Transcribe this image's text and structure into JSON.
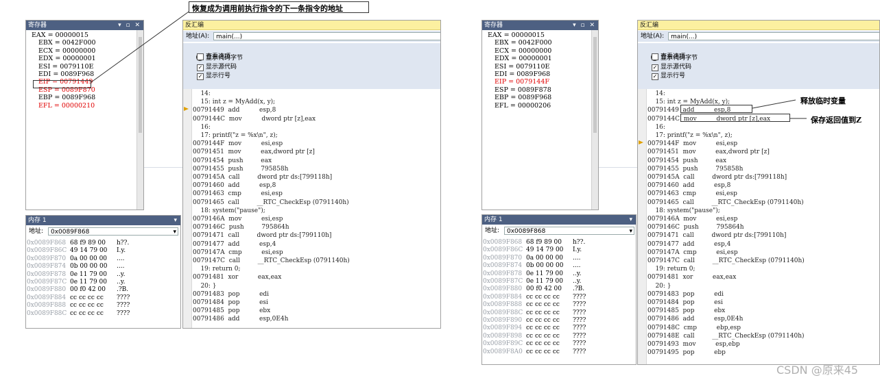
{
  "left": {
    "registers": {
      "title": "寄存器",
      "lines": [
        "EAX = 00000015",
        "EBX = 0042F000",
        "ECX = 00000000",
        "EDX = 00000001",
        "ESI = 0079110E",
        "EDI = 0089F968",
        "EIP = 00791449",
        "ESP = 0089F870",
        "EBP = 0089F968",
        "EFL = 00000210"
      ],
      "red_indices": [
        6,
        7,
        9
      ]
    },
    "disasm": {
      "title": "反汇编",
      "address_label": "地址(A):",
      "address_value": "main(...)",
      "options_header": "查看选项",
      "options": [
        {
          "label": "显示代码字节",
          "checked": false
        },
        {
          "label": "显示源代码",
          "checked": true
        },
        {
          "label": "显示行号",
          "checked": true
        }
      ],
      "code": [
        "    14:",
        "    15: int z = MyAdd(x, y);",
        "00791449  add          esp,8",
        "0079144C  mov          dword ptr [z],eax",
        "    16:",
        "    17: printf(\"z = %x\\n\", z);",
        "0079144F  mov          esi,esp",
        "00791451  mov          eax,dword ptr [z]",
        "00791454  push         eax",
        "00791455  push         795858h",
        "0079145A  call         dword ptr ds:[799118h]",
        "00791460  add          esp,8",
        "00791463  cmp          esi,esp",
        "00791465  call         __RTC_CheckEsp (0791140h)",
        "    18: system(\"pause\");",
        "0079146A  mov          esi,esp",
        "0079146C  push         795864h",
        "00791471  call         dword ptr ds:[799110h]",
        "00791477  add          esp,4",
        "0079147A  cmp          esi,esp",
        "0079147C  call         __RTC_CheckEsp (0791140h)",
        "    19: return 0;",
        "00791481  xor          eax,eax",
        "    20: }",
        "00791483  pop          edi",
        "00791484  pop          esi",
        "00791485  pop          ebx",
        "00791486  add          esp,0E4h"
      ],
      "current_line": 2
    },
    "memory": {
      "title": "内存 1",
      "address_label": "地址:",
      "address_value": "0x0089F868",
      "rows": [
        {
          "addr": "0x0089F868",
          "bytes": "68 f9 89 00",
          "ascii": "h??."
        },
        {
          "addr": "0x0089F86C",
          "bytes": "49 14 79 00",
          "ascii": "I.y."
        },
        {
          "addr": "0x0089F870",
          "bytes": "0a 00 00 00",
          "ascii": "...."
        },
        {
          "addr": "0x0089F874",
          "bytes": "0b 00 00 00",
          "ascii": "...."
        },
        {
          "addr": "0x0089F878",
          "bytes": "0e 11 79 00",
          "ascii": "..y."
        },
        {
          "addr": "0x0089F87C",
          "bytes": "0e 11 79 00",
          "ascii": "..y."
        },
        {
          "addr": "0x0089F880",
          "bytes": "00 f0 42 00",
          "ascii": ".?B."
        },
        {
          "addr": "0x0089F884",
          "bytes": "cc cc cc cc",
          "ascii": "????"
        },
        {
          "addr": "0x0089F888",
          "bytes": "cc cc cc cc",
          "ascii": "????"
        },
        {
          "addr": "0x0089F88C",
          "bytes": "cc cc cc cc",
          "ascii": "????"
        }
      ]
    },
    "annotation": "恢复成为调用前执行指令的下一条指令的地址"
  },
  "right": {
    "registers": {
      "title": "寄存器",
      "lines": [
        "EAX = 00000015",
        "EBX = 0042F000",
        "ECX = 00000000",
        "EDX = 00000001",
        "ESI = 0079110E",
        "EDI = 0089F968",
        "EIP = 0079144F",
        "ESP = 0089F878",
        "EBP = 0089F968",
        "EFL = 00000206"
      ],
      "red_indices": [
        6
      ]
    },
    "disasm": {
      "title": "反汇编",
      "address_label": "地址(A):",
      "address_value": "main(...)",
      "options_header": "查看选项",
      "options": [
        {
          "label": "显示代码字节",
          "checked": false
        },
        {
          "label": "显示源代码",
          "checked": true
        },
        {
          "label": "显示行号",
          "checked": true
        }
      ],
      "code": [
        "    14:",
        "    15: int z = MyAdd(x, y);",
        "00791449  add          esp,8",
        "0079144C  mov          dword ptr [z],eax",
        "    16:",
        "    17: printf(\"z = %x\\n\", z);",
        "0079144F  mov          esi,esp",
        "00791451  mov          eax,dword ptr [z]",
        "00791454  push         eax",
        "00791455  push         795858h",
        "0079145A  call         dword ptr ds:[799118h]",
        "00791460  add          esp,8",
        "00791463  cmp          esi,esp",
        "00791465  call         __RTC_CheckEsp (0791140h)",
        "    18: system(\"pause\");",
        "0079146A  mov          esi,esp",
        "0079146C  push         795864h",
        "00791471  call         dword ptr ds:[799110h]",
        "00791477  add          esp,4",
        "0079147A  cmp          esi,esp",
        "0079147C  call         __RTC_CheckEsp (0791140h)",
        "    19: return 0;",
        "00791481  xor          eax,eax",
        "    20: }",
        "00791483  pop          edi",
        "00791484  pop          esi",
        "00791485  pop          ebx",
        "00791486  add          esp,0E4h",
        "0079148C  cmp          ebp,esp",
        "0079148E  call         __RTC_CheckEsp (0791140h)",
        "00791493  mov          esp,ebp",
        "00791495  pop          ebp"
      ],
      "current_line": 6
    },
    "memory": {
      "title": "内存 1",
      "address_label": "地址:",
      "address_value": "0x0089F868",
      "rows": [
        {
          "addr": "0x0089F868",
          "bytes": "68 f9 89 00",
          "ascii": "h??."
        },
        {
          "addr": "0x0089F86C",
          "bytes": "49 14 79 00",
          "ascii": "I.y."
        },
        {
          "addr": "0x0089F870",
          "bytes": "0a 00 00 00",
          "ascii": "...."
        },
        {
          "addr": "0x0089F874",
          "bytes": "0b 00 00 00",
          "ascii": "...."
        },
        {
          "addr": "0x0089F878",
          "bytes": "0e 11 79 00",
          "ascii": "..y."
        },
        {
          "addr": "0x0089F87C",
          "bytes": "0e 11 79 00",
          "ascii": "..y."
        },
        {
          "addr": "0x0089F880",
          "bytes": "00 f0 42 00",
          "ascii": ".?B."
        },
        {
          "addr": "0x0089F884",
          "bytes": "cc cc cc cc",
          "ascii": "????"
        },
        {
          "addr": "0x0089F888",
          "bytes": "cc cc cc cc",
          "ascii": "????"
        },
        {
          "addr": "0x0089F88C",
          "bytes": "cc cc cc cc",
          "ascii": "????"
        },
        {
          "addr": "0x0089F890",
          "bytes": "cc cc cc cc",
          "ascii": "????"
        },
        {
          "addr": "0x0089F894",
          "bytes": "cc cc cc cc",
          "ascii": "????"
        },
        {
          "addr": "0x0089F898",
          "bytes": "cc cc cc cc",
          "ascii": "????"
        },
        {
          "addr": "0x0089F89C",
          "bytes": "cc cc cc cc",
          "ascii": "????"
        },
        {
          "addr": "0x0089F8A0",
          "bytes": "cc cc cc cc",
          "ascii": "????"
        }
      ]
    },
    "annotation_release": "释放临时变量",
    "annotation_save": "保存返回值到Z"
  },
  "watermark": "CSDN @原来45",
  "colors": {
    "titlebar": "#4d6082",
    "disasm_title": "#fcf0a0",
    "red": "#e00000",
    "arrow": "#e0a000"
  }
}
